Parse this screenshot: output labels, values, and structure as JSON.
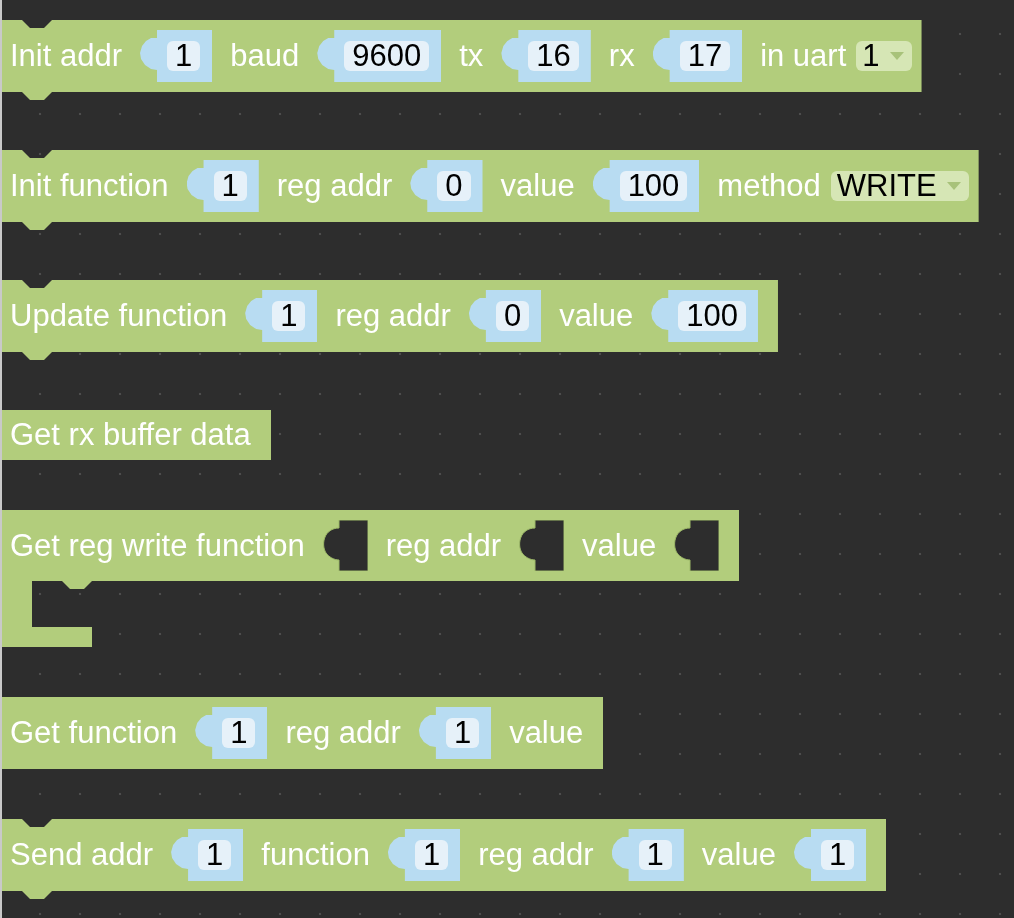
{
  "workspace": {
    "blocks": [
      {
        "kind": "statement",
        "parts": [
          {
            "kind": "label",
            "text": "Init addr"
          },
          {
            "kind": "number",
            "value": "1"
          },
          {
            "kind": "label",
            "text": "baud"
          },
          {
            "kind": "number",
            "value": "9600"
          },
          {
            "kind": "label",
            "text": "tx"
          },
          {
            "kind": "number",
            "value": "16"
          },
          {
            "kind": "label",
            "text": "rx"
          },
          {
            "kind": "number",
            "value": "17"
          },
          {
            "kind": "label",
            "text": "in uart"
          },
          {
            "kind": "dropdown",
            "value": "1"
          }
        ]
      },
      {
        "kind": "statement",
        "parts": [
          {
            "kind": "label",
            "text": "Init function"
          },
          {
            "kind": "number",
            "value": "1"
          },
          {
            "kind": "label",
            "text": "reg addr"
          },
          {
            "kind": "number",
            "value": "0"
          },
          {
            "kind": "label",
            "text": "value"
          },
          {
            "kind": "number",
            "value": "100"
          },
          {
            "kind": "label",
            "text": "method"
          },
          {
            "kind": "dropdown",
            "value": "WRITE"
          }
        ]
      },
      {
        "kind": "statement",
        "parts": [
          {
            "kind": "label",
            "text": "Update function"
          },
          {
            "kind": "number",
            "value": "1"
          },
          {
            "kind": "label",
            "text": "reg addr"
          },
          {
            "kind": "number",
            "value": "0"
          },
          {
            "kind": "label",
            "text": "value"
          },
          {
            "kind": "number",
            "value": "100"
          }
        ]
      },
      {
        "kind": "value",
        "parts": [
          {
            "kind": "label",
            "text": "Get rx buffer data"
          }
        ]
      },
      {
        "kind": "container",
        "parts": [
          {
            "kind": "label",
            "text": "Get reg write function"
          },
          {
            "kind": "empty"
          },
          {
            "kind": "label",
            "text": "reg addr"
          },
          {
            "kind": "empty"
          },
          {
            "kind": "label",
            "text": "value"
          },
          {
            "kind": "empty"
          }
        ]
      },
      {
        "kind": "value",
        "parts": [
          {
            "kind": "label",
            "text": "Get function"
          },
          {
            "kind": "number",
            "value": "1"
          },
          {
            "kind": "label",
            "text": "reg addr"
          },
          {
            "kind": "number",
            "value": "1"
          },
          {
            "kind": "label",
            "text": "value"
          }
        ]
      },
      {
        "kind": "statement",
        "parts": [
          {
            "kind": "label",
            "text": "Send addr"
          },
          {
            "kind": "number",
            "value": "1"
          },
          {
            "kind": "label",
            "text": "function"
          },
          {
            "kind": "number",
            "value": "1"
          },
          {
            "kind": "label",
            "text": "reg addr"
          },
          {
            "kind": "number",
            "value": "1"
          },
          {
            "kind": "label",
            "text": "value"
          },
          {
            "kind": "number",
            "value": "1"
          }
        ]
      }
    ]
  }
}
